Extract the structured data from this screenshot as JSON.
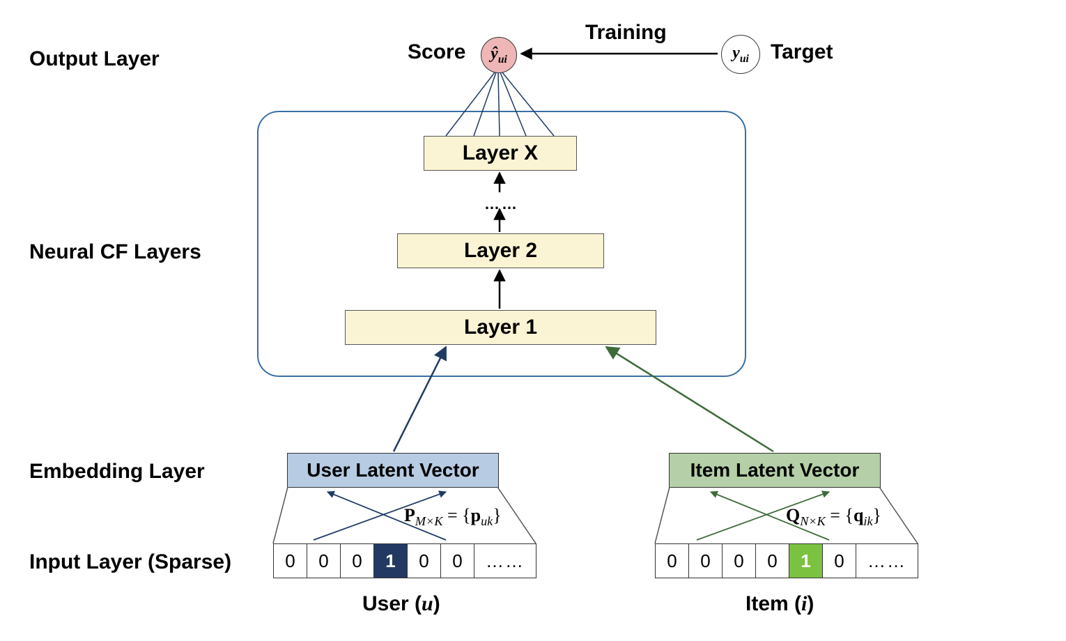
{
  "section_labels": {
    "output": "Output Layer",
    "neural": "Neural CF Layers",
    "embedding": "Embedding Layer",
    "input": "Input Layer (Sparse)"
  },
  "output": {
    "score_label": "Score",
    "training_label": "Training",
    "target_label": "Target"
  },
  "neural_layers": {
    "top": "Layer X",
    "mid": "Layer 2",
    "bottom": "Layer 1",
    "dots": "……"
  },
  "embedding": {
    "user_latent": "User Latent Vector",
    "item_latent": "Item Latent Vector"
  },
  "input": {
    "user_vector": [
      "0",
      "0",
      "0",
      "1",
      "0",
      "0",
      "……"
    ],
    "user_active_index": 3,
    "item_vector": [
      "0",
      "0",
      "0",
      "0",
      "1",
      "0",
      "……"
    ],
    "item_active_index": 4,
    "user_caption_prefix": "User (",
    "user_caption_var": "u",
    "user_caption_suffix": ")",
    "item_caption_prefix": "Item (",
    "item_caption_var": "i",
    "item_caption_suffix": ")"
  },
  "formulas": {
    "P_html": "<span class='b'>P</span><span class='sub it'>M×K</span> = {<span class='b'>p</span><span class='sub it'>uk</span>}",
    "Q_html": "<span class='b'>Q</span><span class='sub it'>N×K</span> = {<span class='b'>q</span><span class='sub it'>ik</span>}",
    "yhat_html": "<span>ŷ</span><span class='sub'>ui</span>",
    "y_html": "<span>y</span><span class='sub'>ui</span>"
  }
}
